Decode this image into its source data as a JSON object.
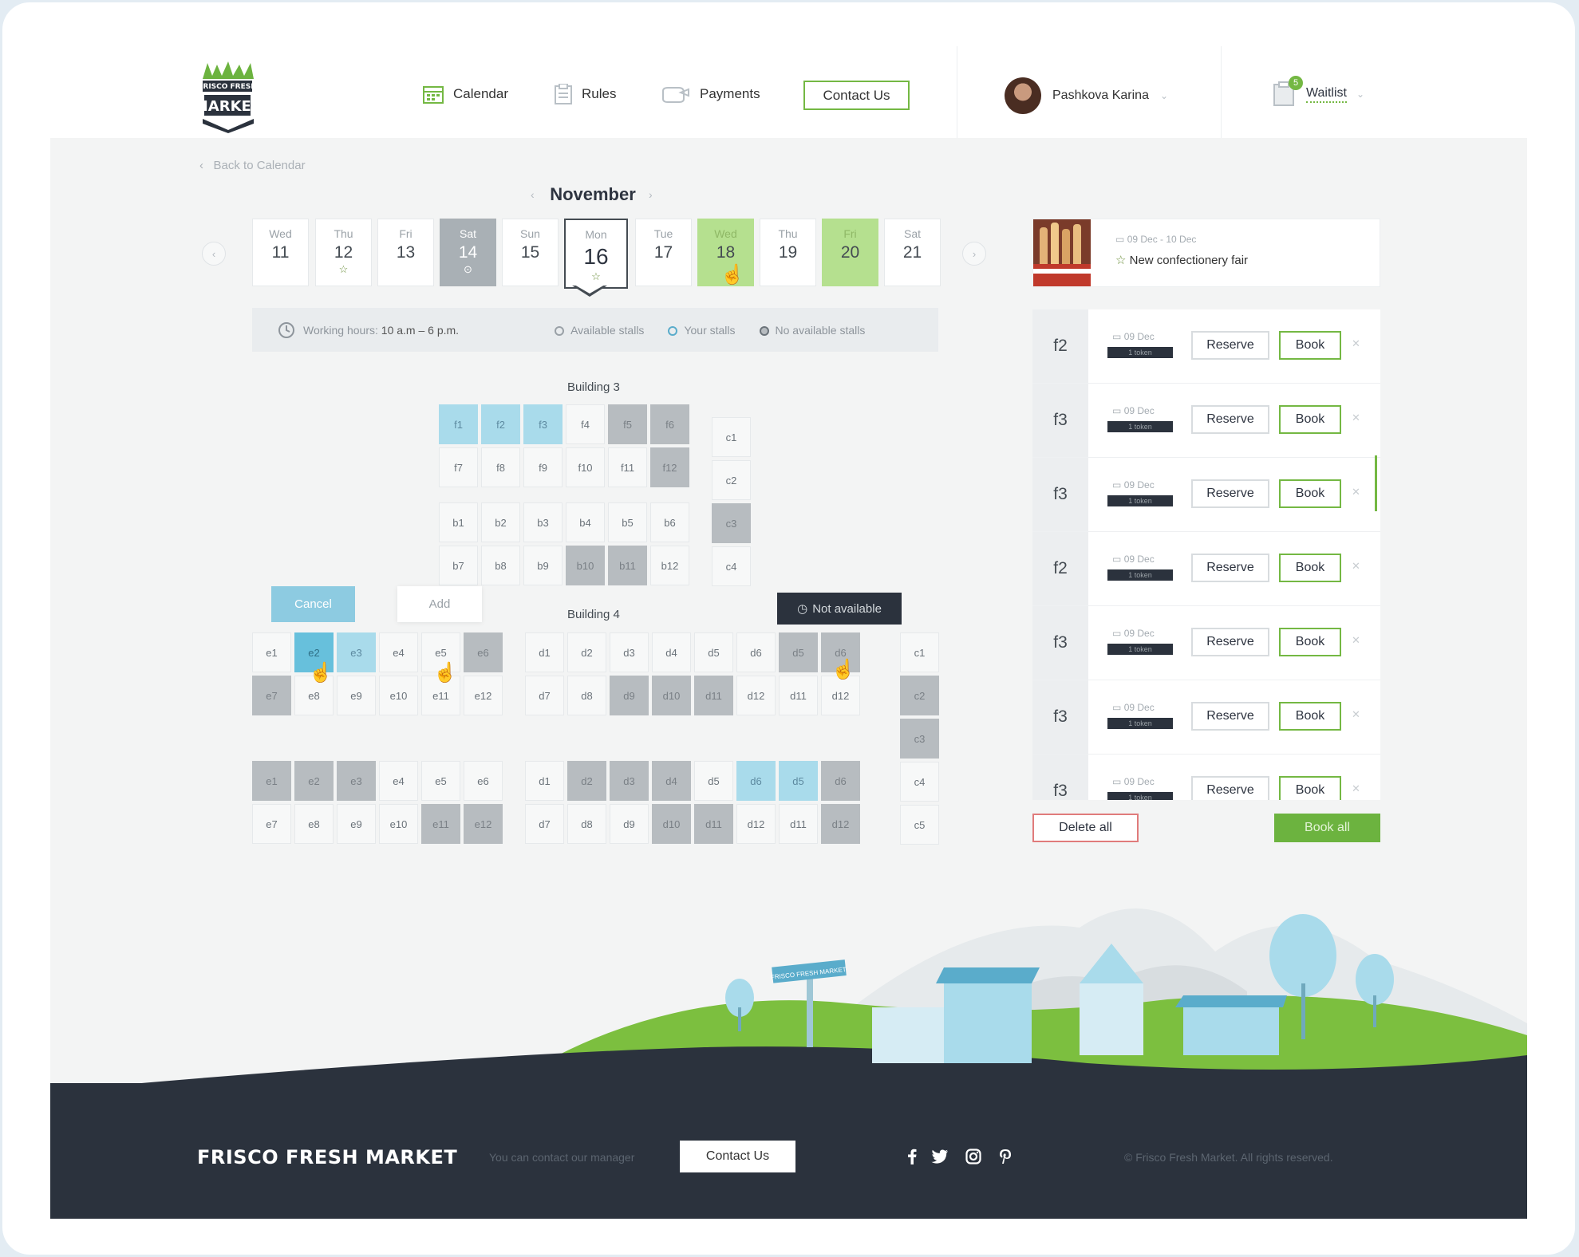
{
  "brand": {
    "name": "FRISCO FRESH MARKET"
  },
  "nav": {
    "items": [
      {
        "label": "Calendar",
        "icon": "calendar-icon"
      },
      {
        "label": "Rules",
        "icon": "clipboard-icon"
      },
      {
        "label": "Payments",
        "icon": "wallet-icon"
      }
    ],
    "contact_label": "Contact Us",
    "user_name": "Pashkova Karina",
    "waitlist_label": "Waitlist",
    "waitlist_count": "5"
  },
  "calendar": {
    "back_label": "Back to Calendar",
    "month": "November",
    "days": [
      {
        "name": "Wed",
        "date": "11",
        "mark": "",
        "state": "normal"
      },
      {
        "name": "Thu",
        "date": "12",
        "mark": "☆",
        "state": "normal"
      },
      {
        "name": "Fri",
        "date": "13",
        "mark": "",
        "state": "normal"
      },
      {
        "name": "Sat",
        "date": "14",
        "mark": "⊙",
        "state": "dark"
      },
      {
        "name": "Sun",
        "date": "15",
        "mark": "",
        "state": "normal"
      },
      {
        "name": "Mon",
        "date": "16",
        "mark": "☆",
        "state": "selected"
      },
      {
        "name": "Tue",
        "date": "17",
        "mark": "",
        "state": "normal"
      },
      {
        "name": "Wed",
        "date": "18",
        "mark": "",
        "state": "green"
      },
      {
        "name": "Thu",
        "date": "19",
        "mark": "",
        "state": "normal"
      },
      {
        "name": "Fri",
        "date": "20",
        "mark": "",
        "state": "green"
      },
      {
        "name": "Sat",
        "date": "21",
        "mark": "",
        "state": "normal"
      }
    ],
    "hours_label": "Working hours:",
    "hours_value": "10 a.m – 6 p.m.",
    "legend": [
      "Available stalls",
      "Your stalls",
      "No available stalls"
    ]
  },
  "map": {
    "building3_label": "Building 3",
    "building4_label": "Building 4",
    "tooltips": {
      "cancel": "Cancel",
      "add": "Add",
      "not_available": "Not available"
    }
  },
  "event": {
    "dates": "09 Dec - 10 Dec",
    "name": "New confectionery fair"
  },
  "bookings": {
    "rows": [
      {
        "code": "f2",
        "date": "09 Dec",
        "tag": "1 token"
      },
      {
        "code": "f3",
        "date": "09 Dec",
        "tag": "1 token"
      },
      {
        "code": "f3",
        "date": "09 Dec",
        "tag": "1 token"
      },
      {
        "code": "f2",
        "date": "09 Dec",
        "tag": "1 token"
      },
      {
        "code": "f3",
        "date": "09 Dec",
        "tag": "1 token"
      },
      {
        "code": "f3",
        "date": "09 Dec",
        "tag": "1 token"
      },
      {
        "code": "f3",
        "date": "09 Dec",
        "tag": "1 token"
      }
    ],
    "reserve_label": "Reserve",
    "book_label": "Book",
    "delete_all": "Delete all",
    "book_all": "Book all"
  },
  "sign_text": "FRISCO FRESH MARKET",
  "footer": {
    "brand": "FRISCO FRESH MARKET",
    "note": "You can contact our manager",
    "contact_label": "Contact Us",
    "social": [
      "facebook-icon",
      "twitter-icon",
      "instagram-icon",
      "pinterest-icon"
    ],
    "copyright": "© Frisco Fresh Market. All rights reserved."
  },
  "colors": {
    "accent": "#74b843",
    "stall_selected": "#67c0dc",
    "stall_yours": "#a9dbeb",
    "stall_unavailable": "#b7bcc0",
    "footer_bg": "#2b323d"
  }
}
